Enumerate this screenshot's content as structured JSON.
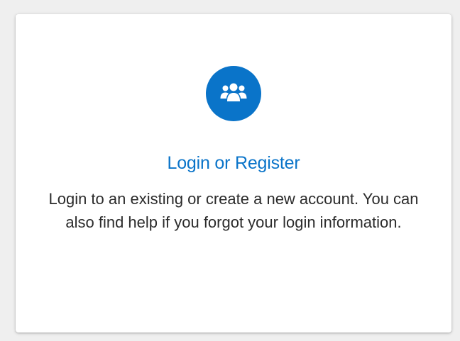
{
  "card": {
    "icon": "users-group-icon",
    "title": "Login or Register",
    "description": "Login to an existing or create a new account. You can also find help if you forgot your login information.",
    "accent_color": "#0a74c9"
  }
}
